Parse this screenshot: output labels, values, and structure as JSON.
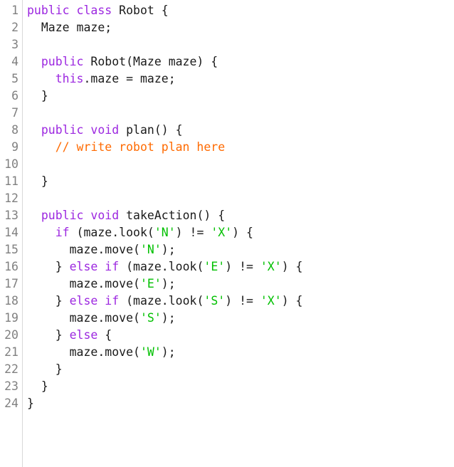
{
  "editor": {
    "language": "java",
    "colors": {
      "background": "#ffffff",
      "text": "#1a1a1a",
      "gutter_text": "#808080",
      "gutter_separator": "#d9d9d9",
      "keyword": "#9c27e0",
      "comment": "#ff6a00",
      "string": "#00c000"
    },
    "total_lines": 24,
    "line_numbers": [
      "1",
      "2",
      "3",
      "4",
      "5",
      "6",
      "7",
      "8",
      "9",
      "10",
      "11",
      "12",
      "13",
      "14",
      "15",
      "16",
      "17",
      "18",
      "19",
      "20",
      "21",
      "22",
      "23",
      "24"
    ],
    "lines": [
      {
        "number": "1",
        "text": "public class Robot {",
        "tokens": [
          {
            "t": "public",
            "c": "keyword"
          },
          {
            "t": " ",
            "c": "plain"
          },
          {
            "t": "class",
            "c": "keyword"
          },
          {
            "t": " Robot {",
            "c": "plain"
          }
        ]
      },
      {
        "number": "2",
        "text": "  Maze maze;",
        "tokens": [
          {
            "t": "  Maze maze;",
            "c": "plain"
          }
        ]
      },
      {
        "number": "3",
        "text": "",
        "tokens": []
      },
      {
        "number": "4",
        "text": "  public Robot(Maze maze) {",
        "tokens": [
          {
            "t": "  ",
            "c": "plain"
          },
          {
            "t": "public",
            "c": "keyword"
          },
          {
            "t": " Robot(Maze maze) {",
            "c": "plain"
          }
        ]
      },
      {
        "number": "5",
        "text": "    this.maze = maze;",
        "tokens": [
          {
            "t": "    ",
            "c": "plain"
          },
          {
            "t": "this",
            "c": "keyword"
          },
          {
            "t": ".maze = maze;",
            "c": "plain"
          }
        ]
      },
      {
        "number": "6",
        "text": "  }",
        "tokens": [
          {
            "t": "  }",
            "c": "plain"
          }
        ]
      },
      {
        "number": "7",
        "text": "",
        "tokens": []
      },
      {
        "number": "8",
        "text": "  public void plan() {",
        "tokens": [
          {
            "t": "  ",
            "c": "plain"
          },
          {
            "t": "public",
            "c": "keyword"
          },
          {
            "t": " ",
            "c": "plain"
          },
          {
            "t": "void",
            "c": "keyword"
          },
          {
            "t": " plan() {",
            "c": "plain"
          }
        ]
      },
      {
        "number": "9",
        "text": "    // write robot plan here",
        "tokens": [
          {
            "t": "    ",
            "c": "plain"
          },
          {
            "t": "// write robot plan here",
            "c": "comment"
          }
        ]
      },
      {
        "number": "10",
        "text": "",
        "tokens": []
      },
      {
        "number": "11",
        "text": "  }",
        "tokens": [
          {
            "t": "  }",
            "c": "plain"
          }
        ]
      },
      {
        "number": "12",
        "text": "",
        "tokens": []
      },
      {
        "number": "13",
        "text": "  public void takeAction() {",
        "tokens": [
          {
            "t": "  ",
            "c": "plain"
          },
          {
            "t": "public",
            "c": "keyword"
          },
          {
            "t": " ",
            "c": "plain"
          },
          {
            "t": "void",
            "c": "keyword"
          },
          {
            "t": " takeAction() {",
            "c": "plain"
          }
        ]
      },
      {
        "number": "14",
        "text": "    if (maze.look('N') != 'X') {",
        "tokens": [
          {
            "t": "    ",
            "c": "plain"
          },
          {
            "t": "if",
            "c": "keyword"
          },
          {
            "t": " (maze.look(",
            "c": "plain"
          },
          {
            "t": "'N'",
            "c": "string"
          },
          {
            "t": ") != ",
            "c": "plain"
          },
          {
            "t": "'X'",
            "c": "string"
          },
          {
            "t": ") {",
            "c": "plain"
          }
        ]
      },
      {
        "number": "15",
        "text": "      maze.move('N');",
        "tokens": [
          {
            "t": "      maze.move(",
            "c": "plain"
          },
          {
            "t": "'N'",
            "c": "string"
          },
          {
            "t": ");",
            "c": "plain"
          }
        ]
      },
      {
        "number": "16",
        "text": "    } else if (maze.look('E') != 'X') {",
        "tokens": [
          {
            "t": "    } ",
            "c": "plain"
          },
          {
            "t": "else",
            "c": "keyword"
          },
          {
            "t": " ",
            "c": "plain"
          },
          {
            "t": "if",
            "c": "keyword"
          },
          {
            "t": " (maze.look(",
            "c": "plain"
          },
          {
            "t": "'E'",
            "c": "string"
          },
          {
            "t": ") != ",
            "c": "plain"
          },
          {
            "t": "'X'",
            "c": "string"
          },
          {
            "t": ") {",
            "c": "plain"
          }
        ]
      },
      {
        "number": "17",
        "text": "      maze.move('E');",
        "tokens": [
          {
            "t": "      maze.move(",
            "c": "plain"
          },
          {
            "t": "'E'",
            "c": "string"
          },
          {
            "t": ");",
            "c": "plain"
          }
        ]
      },
      {
        "number": "18",
        "text": "    } else if (maze.look('S') != 'X') {",
        "tokens": [
          {
            "t": "    } ",
            "c": "plain"
          },
          {
            "t": "else",
            "c": "keyword"
          },
          {
            "t": " ",
            "c": "plain"
          },
          {
            "t": "if",
            "c": "keyword"
          },
          {
            "t": " (maze.look(",
            "c": "plain"
          },
          {
            "t": "'S'",
            "c": "string"
          },
          {
            "t": ") != ",
            "c": "plain"
          },
          {
            "t": "'X'",
            "c": "string"
          },
          {
            "t": ") {",
            "c": "plain"
          }
        ]
      },
      {
        "number": "19",
        "text": "      maze.move('S');",
        "tokens": [
          {
            "t": "      maze.move(",
            "c": "plain"
          },
          {
            "t": "'S'",
            "c": "string"
          },
          {
            "t": ");",
            "c": "plain"
          }
        ]
      },
      {
        "number": "20",
        "text": "    } else {",
        "tokens": [
          {
            "t": "    } ",
            "c": "plain"
          },
          {
            "t": "else",
            "c": "keyword"
          },
          {
            "t": " {",
            "c": "plain"
          }
        ]
      },
      {
        "number": "21",
        "text": "      maze.move('W');",
        "tokens": [
          {
            "t": "      maze.move(",
            "c": "plain"
          },
          {
            "t": "'W'",
            "c": "string"
          },
          {
            "t": ");",
            "c": "plain"
          }
        ]
      },
      {
        "number": "22",
        "text": "    }",
        "tokens": [
          {
            "t": "    }",
            "c": "plain"
          }
        ]
      },
      {
        "number": "23",
        "text": "  }",
        "tokens": [
          {
            "t": "  }",
            "c": "plain"
          }
        ]
      },
      {
        "number": "24",
        "text": "}",
        "tokens": [
          {
            "t": "}",
            "c": "plain"
          }
        ]
      }
    ]
  }
}
